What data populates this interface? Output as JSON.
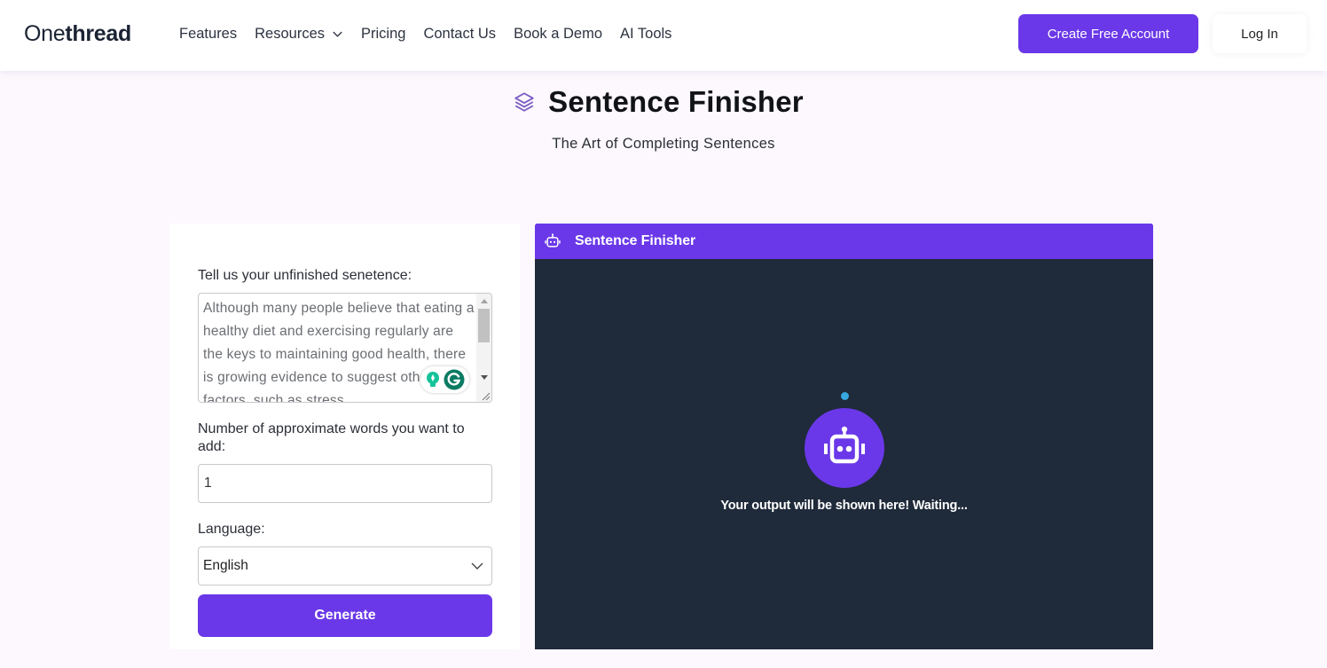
{
  "brand": {
    "logo_light": "One",
    "logo_bold": "thread",
    "accent_color": "#6a38e8",
    "panel_color": "#1f2a3a"
  },
  "nav": {
    "items": [
      {
        "label": "Features",
        "has_dropdown": false
      },
      {
        "label": "Resources",
        "has_dropdown": true
      },
      {
        "label": "Pricing",
        "has_dropdown": false
      },
      {
        "label": "Contact Us",
        "has_dropdown": false
      },
      {
        "label": "Book a Demo",
        "has_dropdown": false
      },
      {
        "label": "AI Tools",
        "has_dropdown": false
      }
    ],
    "create_account_label": "Create Free Account",
    "login_label": "Log In"
  },
  "hero": {
    "icon": "layers-icon",
    "title": "Sentence Finisher",
    "subtitle": "The Art of Completing Sentences"
  },
  "form": {
    "sentence_label": "Tell us your unfinished senetence:",
    "sentence_value": "Although many people believe that eating a healthy diet and exercising regularly are the keys to maintaining good health, there is growing evidence to suggest other factors, such as stress",
    "words_label": "Number of approximate words you want to add:",
    "words_value": "1",
    "language_label": "Language:",
    "language_value": "English",
    "generate_label": "Generate"
  },
  "output": {
    "header_icon": "robot-icon",
    "header_title": "Sentence Finisher",
    "waiting_text": "Your output will be shown here! Waiting..."
  }
}
